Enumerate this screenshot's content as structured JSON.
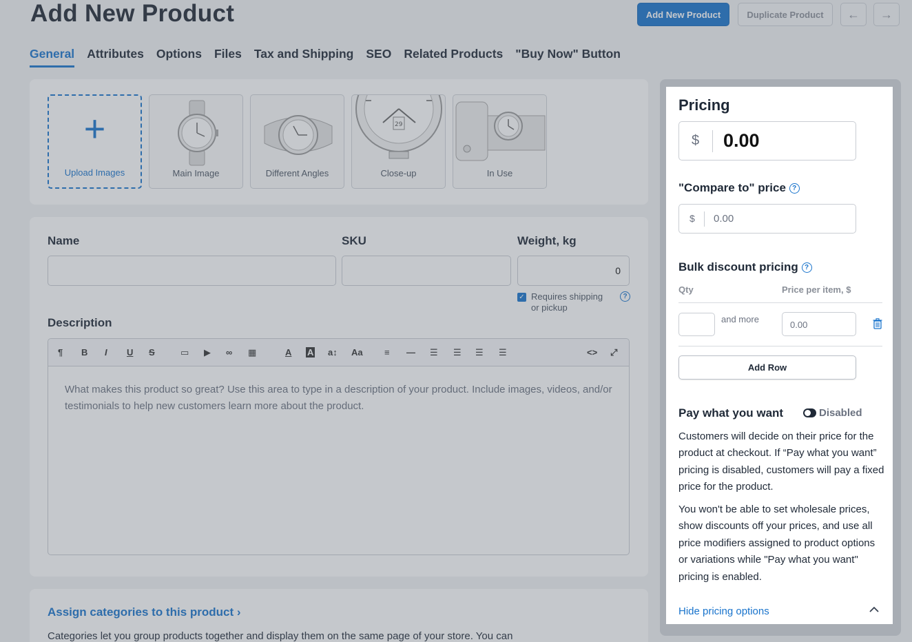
{
  "header": {
    "title": "Add New Product",
    "add_new_label": "Add New Product",
    "duplicate_label": "Duplicate Product",
    "prev_icon": "←",
    "next_icon": "→"
  },
  "tabs": [
    {
      "label": "General",
      "active": true
    },
    {
      "label": "Attributes"
    },
    {
      "label": "Options"
    },
    {
      "label": "Files"
    },
    {
      "label": "Tax and Shipping"
    },
    {
      "label": "SEO"
    },
    {
      "label": "Related Products"
    },
    {
      "label": "\"Buy Now\" Button"
    }
  ],
  "images": {
    "upload_label": "Upload Images",
    "tiles": [
      "Main Image",
      "Different Angles",
      "Close-up",
      "In Use"
    ]
  },
  "form": {
    "name_label": "Name",
    "sku_label": "SKU",
    "weight_label": "Weight, kg",
    "weight_value": "0",
    "requires_shipping": "Requires shipping or pickup",
    "description_label": "Description",
    "description_placeholder": "What makes this product so great? Use this area to type in a description of your product. Include images, videos, and/or testimonials to help new customers learn more about the product."
  },
  "categories": {
    "link": "Assign categories to this product ›",
    "text": "Categories let you group products together and display them on the same page of your store. You can"
  },
  "pricing": {
    "title": "Pricing",
    "currency": "$",
    "price": "0.00",
    "compare_label": "\"Compare to\" price",
    "compare_value": "0.00",
    "bulk_label": "Bulk discount pricing",
    "qty_header": "Qty",
    "ppi_header": "Price per item, $",
    "and_more": "and more",
    "ppi_value": "0.00",
    "add_row": "Add Row",
    "pwyw_label": "Pay what you want",
    "pwyw_status": "Disabled",
    "para1": "Customers will decide on their price for the product at checkout. If “Pay what you want” pricing is disabled, customers will pay a fixed price for the product.",
    "para2": "You won't be able to set wholesale prices, show discounts off your prices, and use all price modifiers assigned to product options or variations while \"Pay what you want\" pricing is enabled.",
    "hide_link": "Hide pricing options",
    "help_glyph": "?"
  },
  "colors": {
    "accent": "#1873cc"
  }
}
